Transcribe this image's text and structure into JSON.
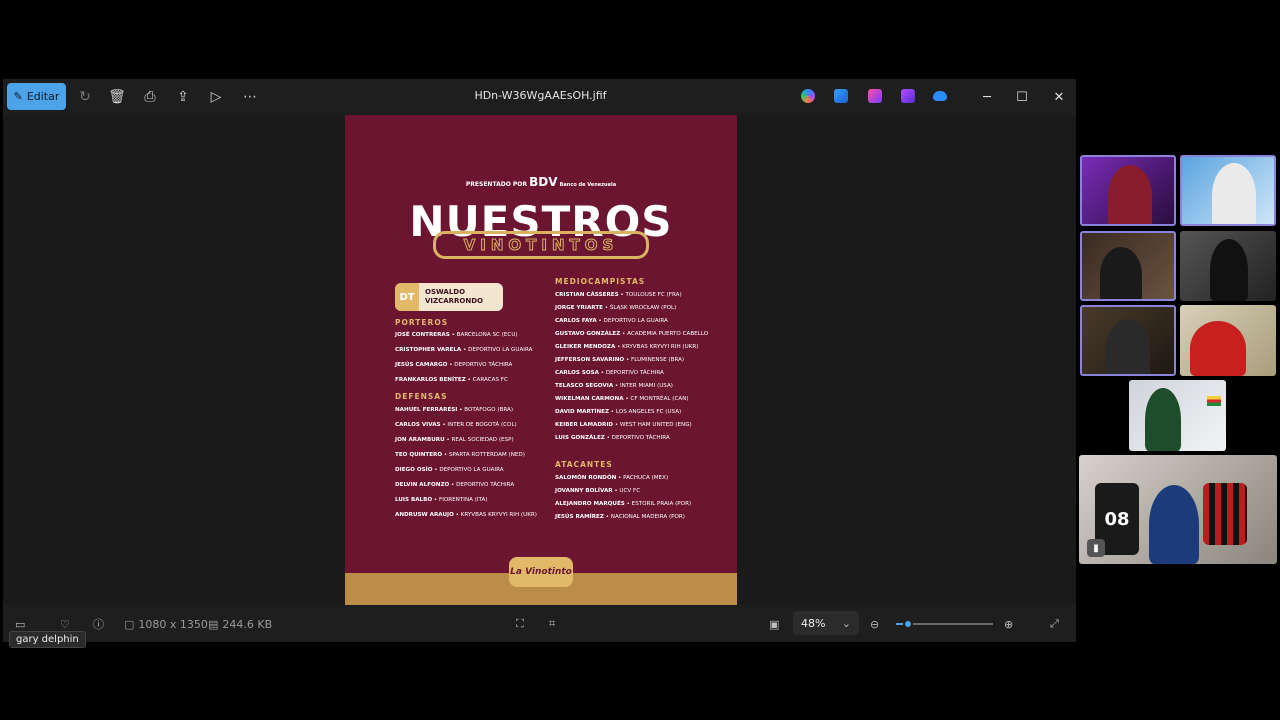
{
  "window": {
    "title": "HDn-W36WgAAEsOH.jfif",
    "edit_label": "Editar"
  },
  "toolbar_icons": [
    "rotate-icon",
    "delete-icon",
    "print-icon",
    "share-icon",
    "slideshow-icon",
    "more-icon"
  ],
  "app_icons": [
    "copilot-icon",
    "editor-icon",
    "clipchamp-icon",
    "designer-icon",
    "onedrive-icon"
  ],
  "bottombar": {
    "dimensions": "1080 x 1350",
    "filesize": "244.6 KB",
    "zoom": "48%",
    "zoom_level": 0.12
  },
  "tooltip": "gary delphin",
  "poster": {
    "presented_by": "PRESENTADO POR",
    "sponsor": "BDV",
    "sponsor_sub": "Banco de Venezuela",
    "title": "NUESTROS",
    "subtitle": "VINOTINTOS",
    "dt_label": "DT",
    "dt_name_1": "OSWALDO",
    "dt_name_2": "VIZCARRONDO",
    "logo": "La Vinotinto",
    "sections": {
      "porteros": "PORTEROS",
      "defensas": "DEFENSAS",
      "mediocampistas": "MEDIOCAMPISTAS",
      "atacantes": "ATACANTES"
    },
    "porteros": [
      {
        "name": "JOSÉ CONTRERAS",
        "club": " • BARCELONA SC (ECU)"
      },
      {
        "name": "CRISTOPHER VARELA",
        "club": " • DEPORTIVO LA GUAIRA"
      },
      {
        "name": "JESÚS CAMARGO",
        "club": " • DEPORTIVO TÁCHIRA"
      },
      {
        "name": "FRANKARLOS BENÍTEZ",
        "club": " • CARACAS FC"
      }
    ],
    "defensas": [
      {
        "name": "NAHUEL FERRARESI",
        "club": " • BOTAFOGO (BRA)"
      },
      {
        "name": "CARLOS VIVAS",
        "club": " • INTER DE BOGOTÁ (COL)"
      },
      {
        "name": "JON ARAMBURU",
        "club": " • REAL SOCIEDAD (ESP)"
      },
      {
        "name": "TEO QUINTERO",
        "club": " • SPARTA ROTTERDAM (NED)"
      },
      {
        "name": "DIEGO OSÍO",
        "club": " • DEPORTIVO LA GUAIRA"
      },
      {
        "name": "DELVIN ALFONZO",
        "club": " • DEPORTIVO TÁCHIRA"
      },
      {
        "name": "LUIS BALBO",
        "club": " • FIORENTINA (ITA)"
      },
      {
        "name": "ANDRUSW ARAUJO",
        "club": " • KRYVBAS KRYVYI RIH (UKR)"
      }
    ],
    "mediocampistas": [
      {
        "name": "CRISTIAN CÁSSERES",
        "club": " • TOULOUSE FC (FRA)"
      },
      {
        "name": "JORGE YRIARTE",
        "club": " • ŚLĄSK WROCŁAW (POL)"
      },
      {
        "name": "CARLOS FAYA",
        "club": " • DEPORTIVO LA GUAIRA"
      },
      {
        "name": "GUSTAVO GONZÁLEZ",
        "club": " • ACADEMIA PUERTO CABELLO"
      },
      {
        "name": "GLEIKER MENDOZA",
        "club": " • KRYVBAS KRYVYI RIH (UKR)"
      },
      {
        "name": "JEFFERSON SAVARINO",
        "club": " • FLUMINENSE (BRA)"
      },
      {
        "name": "CARLOS SOSA",
        "club": " • DEPORTIVO TÁCHIRA"
      },
      {
        "name": "TELASCO SEGOVIA",
        "club": " • INTER MIAMI (USA)"
      },
      {
        "name": "WIKELMAN CARMONA",
        "club": " • CF MONTRÉAL (CAN)"
      },
      {
        "name": "DAVID MARTÍNEZ",
        "club": " • LOS ANGELES FC (USA)"
      },
      {
        "name": "KEIBER LAMADRID",
        "club": " • WEST HAM UNITED (ENG)"
      },
      {
        "name": "LUIS GONZÁLEZ",
        "club": " • DEPORTIVO TÁCHIRA"
      }
    ],
    "atacantes": [
      {
        "name": "SALOMÓN RONDÓN",
        "club": " • PACHUCA (MEX)"
      },
      {
        "name": "JOVANNY BOLÍVAR",
        "club": " • UCV FC"
      },
      {
        "name": "ALEJANDRO MARQUÉS",
        "club": " • ESTORIL PRAIA (POR)"
      },
      {
        "name": "JESÚS RAMÍREZ",
        "club": " • NACIONAL MADEIRA (POR)"
      }
    ]
  },
  "participants": {
    "jersey_number": "08",
    "tiles": 8
  }
}
